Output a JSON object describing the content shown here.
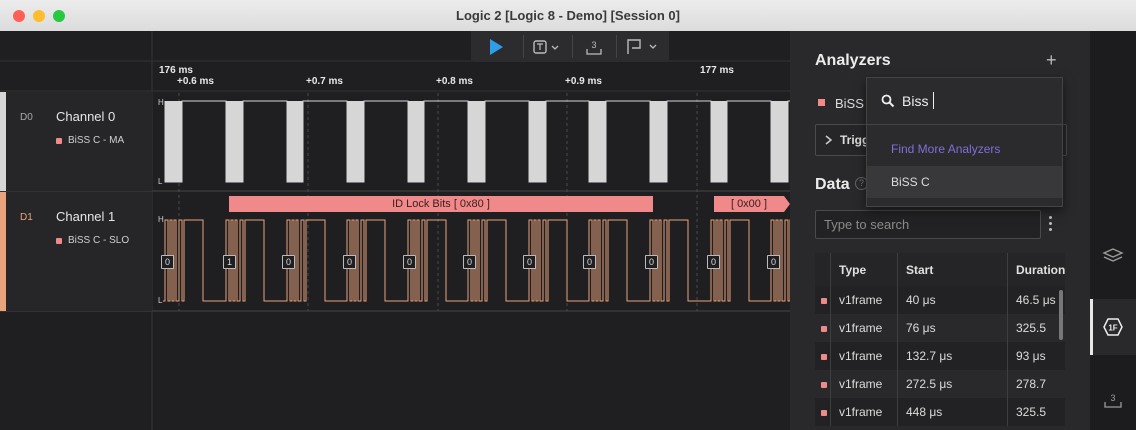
{
  "window": {
    "title": "Logic 2 [Logic 8 - Demo] [Session 0]"
  },
  "ruler": {
    "major": [
      "176 ms",
      "177 ms"
    ],
    "minor": [
      "+0.6 ms",
      "+0.7 ms",
      "+0.8 ms",
      "+0.9 ms"
    ]
  },
  "channels": [
    {
      "id": "D0",
      "name": "Channel 0",
      "analyzer": "BiSS C - MA",
      "color": "#d6d6d6"
    },
    {
      "id": "D1",
      "name": "Channel 1",
      "analyzer": "BiSS C - SLO",
      "color": "#e8a27c"
    }
  ],
  "levels": {
    "high": "H",
    "low": "L"
  },
  "decoded": {
    "frames": [
      "ID Lock Bits [ 0x80 ]",
      "[ 0x00 ]"
    ],
    "bits": [
      "0",
      "1",
      "0",
      "0",
      "0",
      "0",
      "0",
      "0",
      "0",
      "0",
      "0"
    ]
  },
  "analyzers": {
    "title": "Analyzers",
    "add_icon": "+",
    "item_label": "BiSS",
    "trigger_label": "Trigg",
    "search_value": "Biss",
    "find_more": "Find More Analyzers",
    "result": "BiSS C"
  },
  "data": {
    "title": "Data",
    "help_icon": "?",
    "search_placeholder": "Type to search",
    "columns": [
      "Type",
      "Start",
      "Duration"
    ],
    "rows": [
      {
        "type": "v1frame",
        "start": "40 μs",
        "duration": "46.5 μs"
      },
      {
        "type": "v1frame",
        "start": "76 μs",
        "duration": "325.5"
      },
      {
        "type": "v1frame",
        "start": "132.7 μs",
        "duration": "93 μs"
      },
      {
        "type": "v1frame",
        "start": "272.5 μs",
        "duration": "278.7"
      },
      {
        "type": "v1frame",
        "start": "448 μs",
        "duration": "325.5"
      }
    ]
  },
  "sidebar": {
    "timing_label": "3"
  },
  "colors": {
    "accent": "#2f9ee8",
    "analyzer": "#f08a8a",
    "link": "#7f6fd8"
  }
}
